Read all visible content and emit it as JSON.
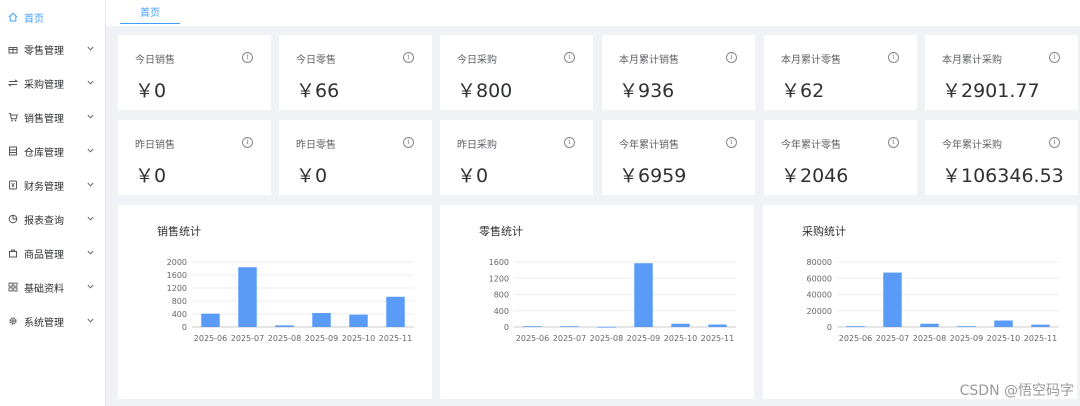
{
  "sidebar": {
    "items": [
      {
        "label": "首页",
        "icon": "home-icon",
        "active": true
      },
      {
        "label": "零售管理",
        "icon": "gift-icon"
      },
      {
        "label": "采购管理",
        "icon": "swap-icon"
      },
      {
        "label": "销售管理",
        "icon": "cart-icon"
      },
      {
        "label": "仓库管理",
        "icon": "box-icon"
      },
      {
        "label": "财务管理",
        "icon": "money-icon"
      },
      {
        "label": "报表查询",
        "icon": "pie-icon"
      },
      {
        "label": "商品管理",
        "icon": "goods-icon"
      },
      {
        "label": "基础资料",
        "icon": "grid-icon"
      },
      {
        "label": "系统管理",
        "icon": "gear-icon"
      }
    ]
  },
  "tabs": [
    {
      "label": "首页"
    }
  ],
  "stats": {
    "row1": [
      {
        "title": "今日销售",
        "value": "￥0"
      },
      {
        "title": "今日零售",
        "value": "￥66"
      },
      {
        "title": "今日采购",
        "value": "￥800"
      },
      {
        "title": "本月累计销售",
        "value": "￥936"
      },
      {
        "title": "本月累计零售",
        "value": "￥62"
      },
      {
        "title": "本月累计采购",
        "value": "￥2901.77"
      }
    ],
    "row2": [
      {
        "title": "昨日销售",
        "value": "￥0"
      },
      {
        "title": "昨日零售",
        "value": "￥0"
      },
      {
        "title": "昨日采购",
        "value": "￥0"
      },
      {
        "title": "今年累计销售",
        "value": "￥6959"
      },
      {
        "title": "今年累计零售",
        "value": "￥2046"
      },
      {
        "title": "今年累计采购",
        "value": "￥106346.53"
      }
    ],
    "info_icon": "info-icon"
  },
  "chart_data": [
    {
      "type": "bar",
      "title": "销售统计",
      "categories": [
        "2025-06",
        "2025-07",
        "2025-08",
        "2025-09",
        "2025-10",
        "2025-11"
      ],
      "values": [
        410,
        1840,
        50,
        430,
        380,
        930
      ],
      "yticks": [
        0,
        400,
        800,
        1200,
        1600,
        2000
      ],
      "ylim": [
        0,
        2000
      ],
      "color": "#5b9bf8"
    },
    {
      "type": "bar",
      "title": "零售统计",
      "categories": [
        "2025-06",
        "2025-07",
        "2025-08",
        "2025-09",
        "2025-10",
        "2025-11"
      ],
      "values": [
        20,
        20,
        5,
        1570,
        80,
        60
      ],
      "yticks": [
        0,
        400,
        800,
        1200,
        1600
      ],
      "ylim": [
        0,
        1600
      ],
      "color": "#5b9bf8"
    },
    {
      "type": "bar",
      "title": "采购统计",
      "categories": [
        "2025-06",
        "2025-07",
        "2025-08",
        "2025-09",
        "2025-10",
        "2025-11"
      ],
      "values": [
        1000,
        67000,
        4000,
        1000,
        8000,
        2900
      ],
      "yticks": [
        0,
        20000,
        40000,
        60000,
        80000
      ],
      "ylim": [
        0,
        80000
      ],
      "color": "#5b9bf8"
    }
  ],
  "watermark": "CSDN @悟空码字"
}
